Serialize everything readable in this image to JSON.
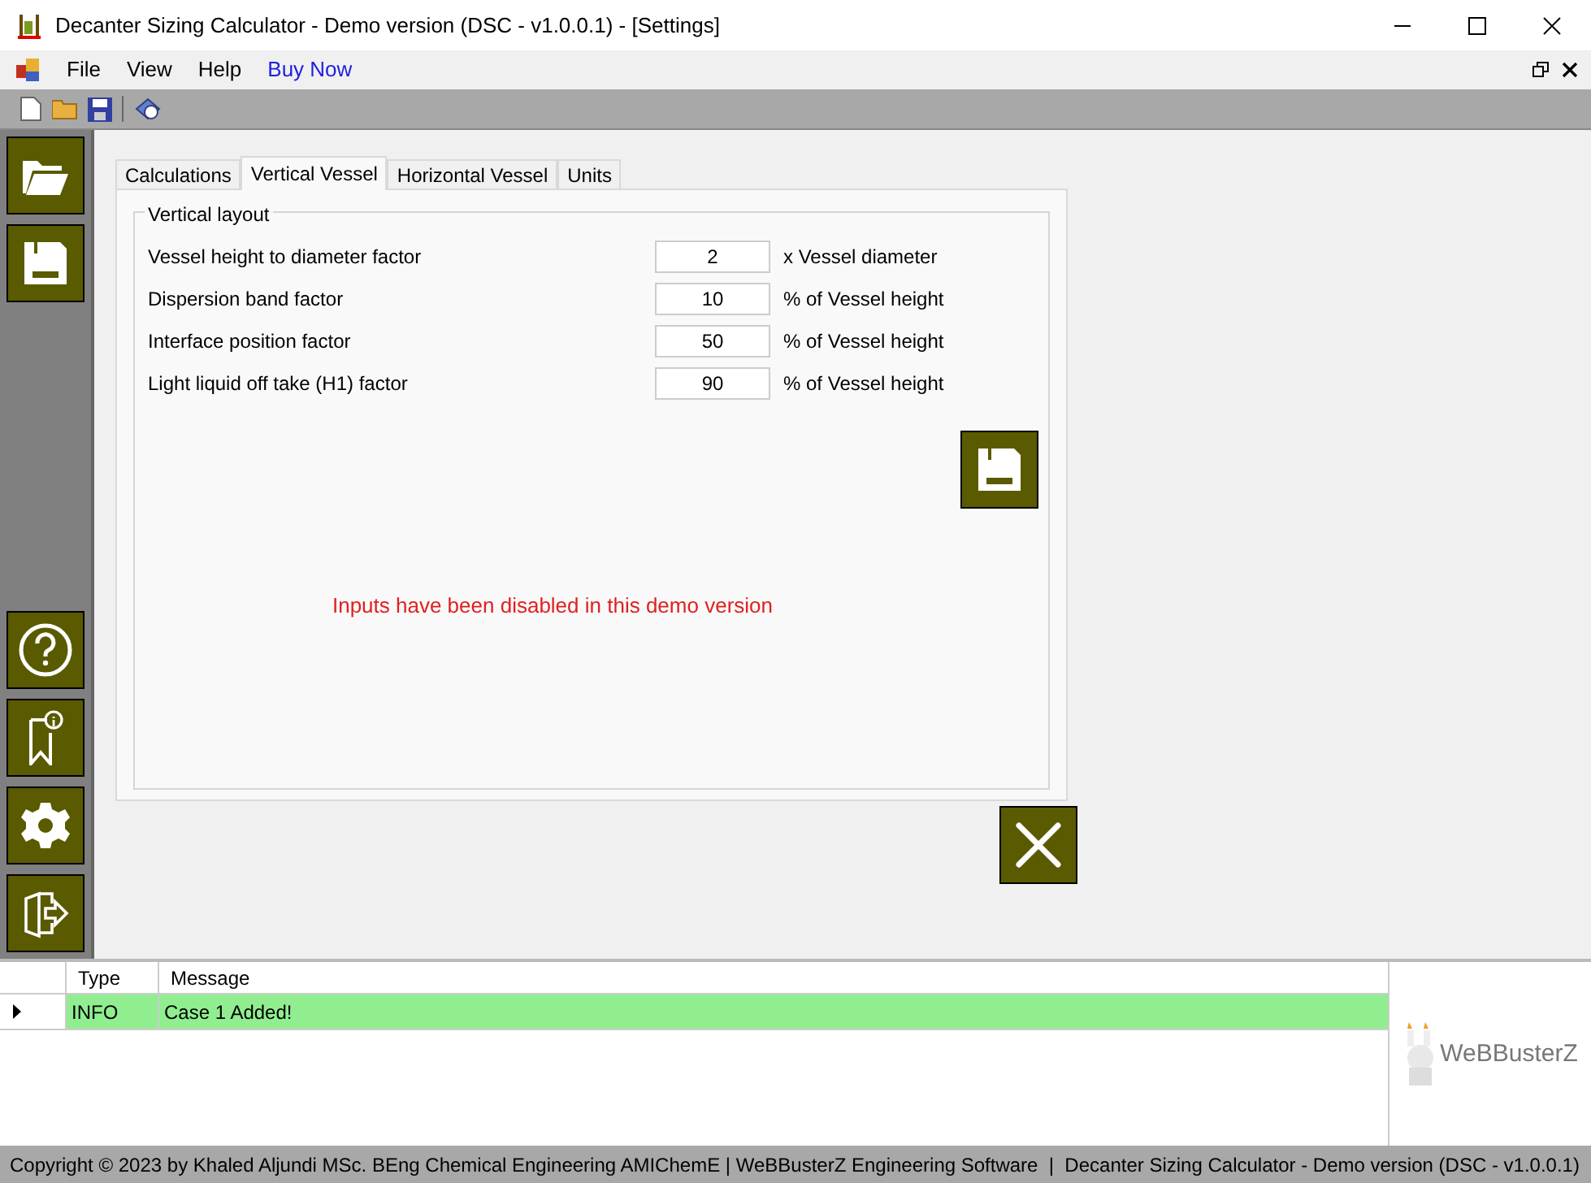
{
  "window": {
    "title": "Decanter Sizing Calculator - Demo version (DSC - v1.0.0.1) - [Settings]"
  },
  "menu": [
    {
      "label": "File",
      "kind": "menu"
    },
    {
      "label": "View",
      "kind": "menu"
    },
    {
      "label": "Help",
      "kind": "menu"
    },
    {
      "label": "Buy Now",
      "kind": "link"
    }
  ],
  "tabs": [
    {
      "label": "Calculations",
      "selected": false
    },
    {
      "label": "Vertical Vessel",
      "selected": true
    },
    {
      "label": "Horizontal Vessel",
      "selected": false
    },
    {
      "label": "Units",
      "selected": false
    }
  ],
  "group": {
    "title": "Vertical layout",
    "rows": [
      {
        "label": "Vessel height to diameter factor",
        "value": "2",
        "unit": "x Vessel diameter"
      },
      {
        "label": "Dispersion band factor",
        "value": "10",
        "unit": "% of Vessel height"
      },
      {
        "label": "Interface position factor",
        "value": "50",
        "unit": "% of Vessel height"
      },
      {
        "label": "Light liquid off take (H1) factor",
        "value": "90",
        "unit": "% of Vessel height"
      }
    ]
  },
  "notice": "Inputs have been disabled in this demo version",
  "log": {
    "columns": [
      "Type",
      "Message"
    ],
    "rows": [
      {
        "type": "INFO",
        "message": "Case 1 Added!",
        "selected": true,
        "color": "#90ee90"
      }
    ]
  },
  "logo": "WeBBusterZ",
  "status_bar": "Copyright © 2023 by Khaled Aljundi MSc. BEng Chemical Engineering AMIChemE | WeBBusterZ Engineering Software  |  Decanter Sizing Calculator - Demo version (DSC - v1.0.0.1)"
}
